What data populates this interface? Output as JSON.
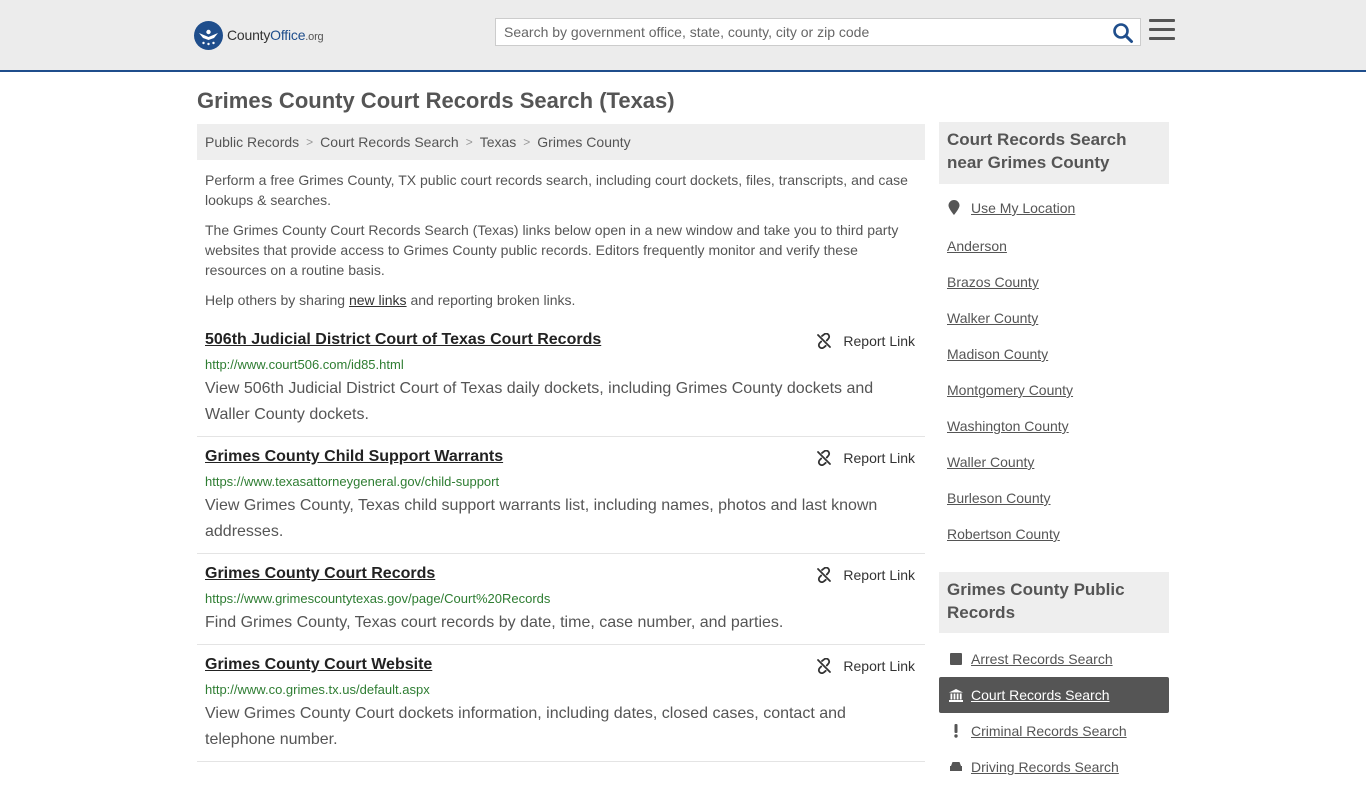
{
  "header": {
    "logo_main": "County",
    "logo_accent": "Office",
    "logo_tld": ".org",
    "search_placeholder": "Search by government office, state, county, city or zip code"
  },
  "page": {
    "title": "Grimes County Court Records Search (Texas)"
  },
  "breadcrumb": [
    "Public Records",
    "Court Records Search",
    "Texas",
    "Grimes County"
  ],
  "intro": {
    "p1": "Perform a free Grimes County, TX public court records search, including court dockets, files, transcripts, and case lookups & searches.",
    "p2": "The Grimes County Court Records Search (Texas) links below open in a new window and take you to third party websites that provide access to Grimes County public records. Editors frequently monitor and verify these resources on a routine basis.",
    "p3_before": "Help others by sharing ",
    "p3_link": "new links",
    "p3_after": " and reporting broken links."
  },
  "report_label": "Report Link",
  "results": [
    {
      "title": "506th Judicial District Court of Texas Court Records",
      "url": "http://www.court506.com/id85.html",
      "desc": "View 506th Judicial District Court of Texas daily dockets, including Grimes County dockets and Waller County dockets."
    },
    {
      "title": "Grimes County Child Support Warrants",
      "url": "https://www.texasattorneygeneral.gov/child-support",
      "desc": "View Grimes County, Texas child support warrants list, including names, photos and last known addresses."
    },
    {
      "title": "Grimes County Court Records",
      "url": "https://www.grimescountytexas.gov/page/Court%20Records",
      "desc": "Find Grimes County, Texas court records by date, time, case number, and parties."
    },
    {
      "title": "Grimes County Court Website",
      "url": "http://www.co.grimes.tx.us/default.aspx",
      "desc": "View Grimes County Court dockets information, including dates, closed cases, contact and telephone number."
    }
  ],
  "sidebar": {
    "near_title": "Court Records Search near Grimes County",
    "use_location": "Use My Location",
    "nearby": [
      "Anderson",
      "Brazos County",
      "Walker County",
      "Madison County",
      "Montgomery County",
      "Washington County",
      "Waller County",
      "Burleson County",
      "Robertson County"
    ],
    "public_title": "Grimes County Public Records",
    "public_items": [
      {
        "label": "Arrest Records Search",
        "icon": "square-icon"
      },
      {
        "label": "Court Records Search",
        "icon": "courthouse-icon",
        "active": true
      },
      {
        "label": "Criminal Records Search",
        "icon": "exclamation-icon"
      },
      {
        "label": "Driving Records Search",
        "icon": "car-icon"
      }
    ]
  },
  "colors": {
    "brand": "#1f4e8c",
    "url_green": "#2e7d32",
    "active_bg": "#555555"
  }
}
